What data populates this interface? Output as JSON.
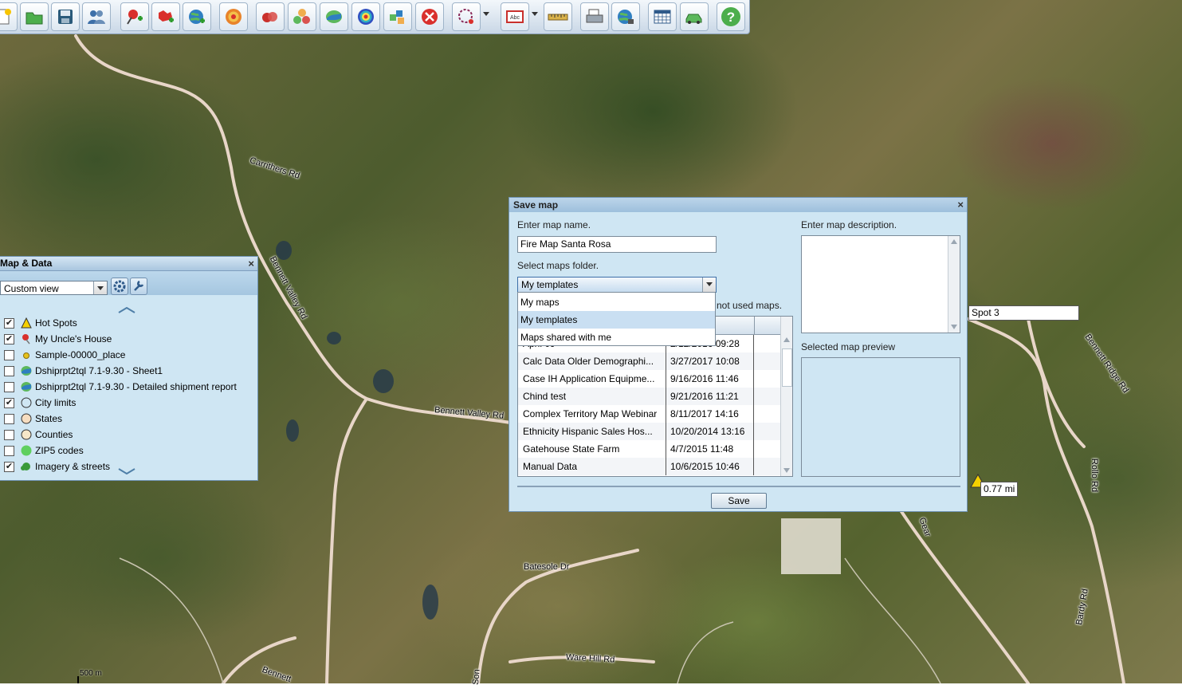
{
  "map": {
    "road_labels": [
      "Carrithers Rd",
      "Bennett Valley Rd",
      "Bennett Valley Rd",
      "Bennett Ridge Rd",
      "Rollo Rd",
      "Batesole Dr",
      "Ware Hill Rd",
      "Bardy Rd",
      "Bennett",
      "Son",
      "Gear"
    ],
    "tags": {
      "spot3": "Spot 3",
      "distance": "0.77 mi"
    },
    "scale": "500 m"
  },
  "toolbar": {
    "icons": [
      "new-icon",
      "open-folder-icon",
      "save-icon",
      "users-icon",
      "add-pushpin-icon",
      "add-territory-icon",
      "add-layer-globe-icon",
      "target-icon",
      "bubble-icon",
      "cluster-icon",
      "shape-map-icon",
      "heatmap-icon",
      "plugin-icon",
      "clear-icon",
      "lasso-icon",
      "text-label-icon",
      "ruler-icon",
      "print-icon",
      "share-globe-icon",
      "calendar-icon",
      "route-car-icon",
      "help-icon"
    ]
  },
  "panel": {
    "title": "Map & Data",
    "view_select": "Custom view",
    "layers": [
      {
        "label": "Hot Spots",
        "checked": true,
        "icon": "triangle-warning-icon"
      },
      {
        "label": "My Uncle's House",
        "checked": true,
        "icon": "pushpin-icon"
      },
      {
        "label": "Sample-00000_place",
        "checked": false,
        "icon": "dot-icon"
      },
      {
        "label": "Dshiprpt2tql 7.1-9.30 - Sheet1",
        "checked": false,
        "icon": "shape-layer-icon"
      },
      {
        "label": "Dshiprpt2tql 7.1-9.30 - Detailed shipment report",
        "checked": false,
        "icon": "shape-layer-icon"
      },
      {
        "label": "City limits",
        "checked": true,
        "icon": "circle-outline-icon"
      },
      {
        "label": "States",
        "checked": false,
        "icon": "circle-outline-icon"
      },
      {
        "label": "Counties",
        "checked": false,
        "icon": "circle-outline-icon"
      },
      {
        "label": "ZIP5 codes",
        "checked": false,
        "icon": "circle-filled-icon"
      },
      {
        "label": "Imagery & streets",
        "checked": true,
        "icon": "imagery-icon"
      }
    ]
  },
  "dialog": {
    "title": "Save map",
    "name_label": "Enter map name.",
    "name_value": "Fire Map Santa Rosa",
    "folder_label": "Select maps folder.",
    "folder_value": "My templates",
    "folder_options": [
      "My maps",
      "My templates",
      "Maps shared with me"
    ],
    "hidden_hint": "not used maps.",
    "description_label": "Enter map description.",
    "preview_label": "Selected map preview",
    "rows": [
      {
        "name": "April 09",
        "date": "2/12/2016 09:28"
      },
      {
        "name": "Calc Data Older Demographi...",
        "date": "3/27/2017 10:08"
      },
      {
        "name": "Case IH Application Equipme...",
        "date": "9/16/2016 11:46"
      },
      {
        "name": "Chind test",
        "date": "9/21/2016 11:21"
      },
      {
        "name": "Complex Territory Map Webinar",
        "date": "8/11/2017 14:16"
      },
      {
        "name": "Ethnicity Hispanic Sales Hos...",
        "date": "10/20/2014 13:16"
      },
      {
        "name": "Gatehouse State Farm",
        "date": "4/7/2015 11:48"
      },
      {
        "name": "Manual Data",
        "date": "10/6/2015 10:46"
      }
    ],
    "save_label": "Save"
  }
}
